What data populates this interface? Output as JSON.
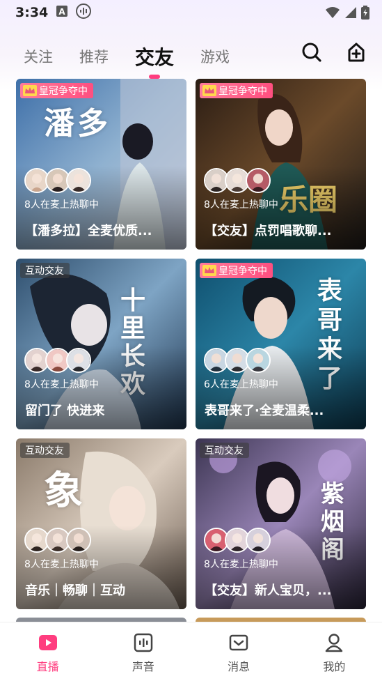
{
  "status": {
    "time": "3:34"
  },
  "tabs": [
    {
      "label": "关注"
    },
    {
      "label": "推荐"
    },
    {
      "label": "交友",
      "active": true
    },
    {
      "label": "游戏"
    }
  ],
  "actions": {
    "search_icon": "search-icon",
    "add_icon": "add-room-icon"
  },
  "cards": [
    {
      "badge": "皇冠争夺中",
      "badge_type": "crown",
      "mic_count": "8人在麦上热聊中",
      "title": "【潘多拉】全麦优质...",
      "deco": "潘多"
    },
    {
      "badge": "皇冠争夺中",
      "badge_type": "crown",
      "mic_count": "8人在麦上热聊中",
      "title": "【交友】点罚唱歌聊...",
      "deco": "乐圈"
    },
    {
      "badge": "互动交友",
      "badge_type": "friend",
      "mic_count": "8人在麦上热聊中",
      "title": "留门了 快进来",
      "deco": "十里长欢"
    },
    {
      "badge": "皇冠争夺中",
      "badge_type": "crown",
      "mic_count": "6人在麦上热聊中",
      "title": "表哥来了·全麦温柔...",
      "deco": "表哥来了"
    },
    {
      "badge": "互动交友",
      "badge_type": "friend",
      "mic_count": "8人在麦上热聊中",
      "title": "音乐｜畅聊｜互动",
      "deco": "象"
    },
    {
      "badge": "互动交友",
      "badge_type": "friend",
      "mic_count": "8人在麦上热聊中",
      "title": "【交友】新人宝贝，...",
      "deco": "紫烟阁"
    }
  ],
  "colors": {
    "accent": "#ff3d7f"
  },
  "nav": [
    {
      "label": "直播",
      "icon": "live-icon",
      "active": true
    },
    {
      "label": "声音",
      "icon": "voice-icon"
    },
    {
      "label": "消息",
      "icon": "message-icon"
    },
    {
      "label": "我的",
      "icon": "profile-icon"
    }
  ]
}
